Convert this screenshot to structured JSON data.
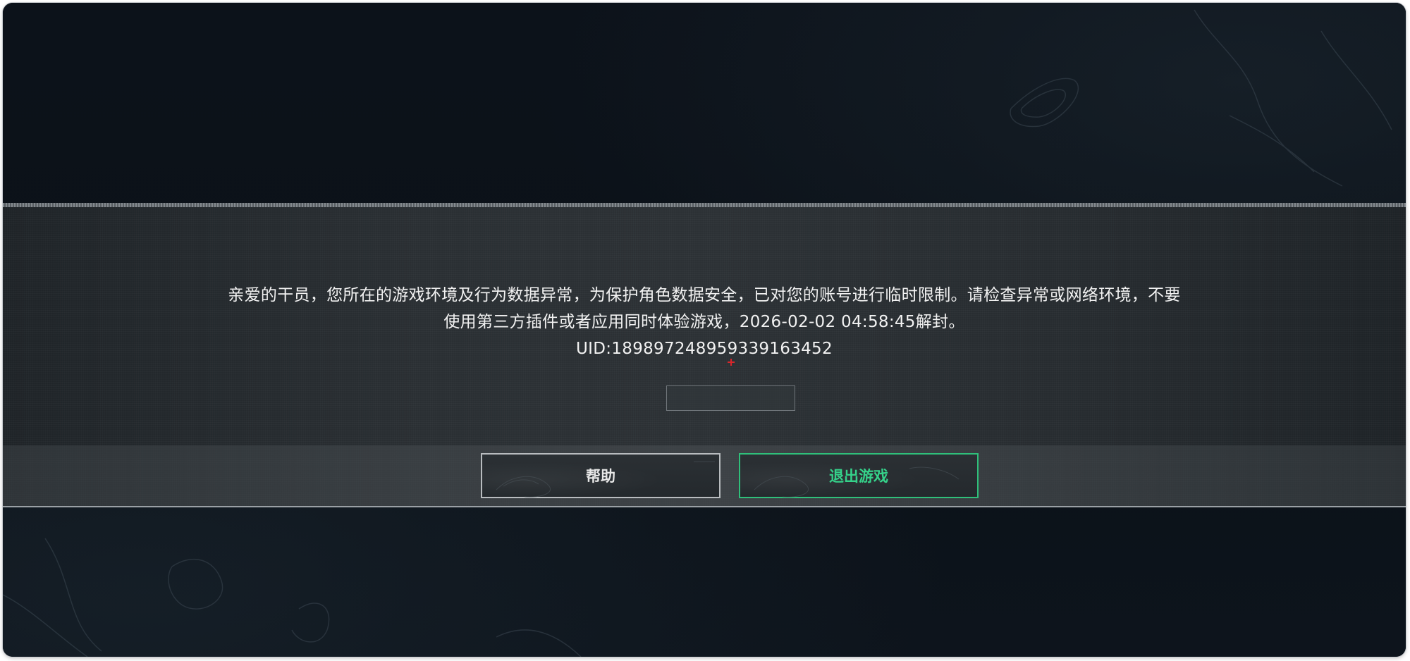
{
  "dialog": {
    "message_line1": "亲爱的干员，您所在的游戏环境及行为数据异常，为保护角色数据安全，已对您的账号进行临时限制。请检查异常或网络环境，不要",
    "message_line2": "使用第三方插件或者应用同时体验游戏，2026-02-02 04:58:45解封。",
    "uid_line": "UID:1898972489593391634​52"
  },
  "buttons": {
    "help_label": "帮助",
    "exit_label": "退出游戏"
  },
  "colors": {
    "background": "#0b1017",
    "band": "#2a2f33",
    "accent_green": "#35d28a",
    "marker_red": "#d8262b"
  },
  "icons": {
    "marker": "red-cross-icon"
  }
}
